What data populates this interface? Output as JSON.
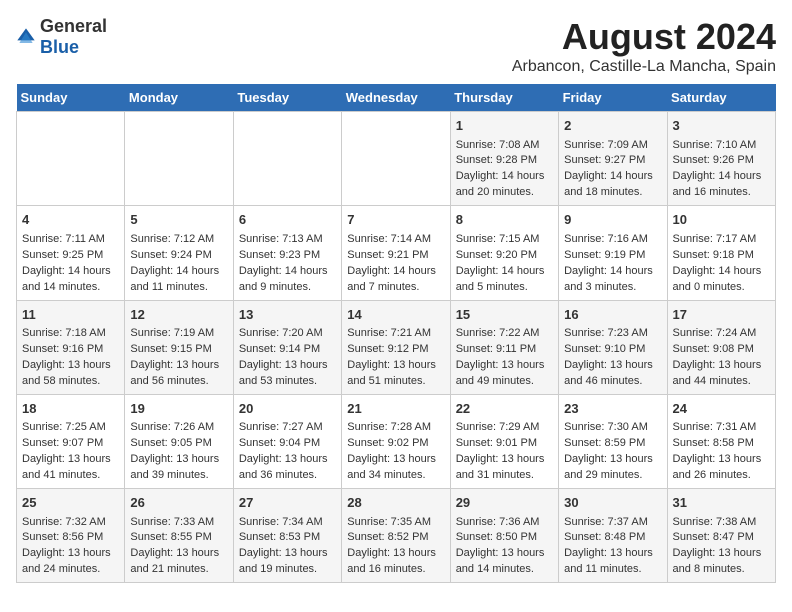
{
  "header": {
    "logo_general": "General",
    "logo_blue": "Blue",
    "title": "August 2024",
    "subtitle": "Arbancon, Castille-La Mancha, Spain"
  },
  "weekdays": [
    "Sunday",
    "Monday",
    "Tuesday",
    "Wednesday",
    "Thursday",
    "Friday",
    "Saturday"
  ],
  "weeks": [
    [
      {
        "day": "",
        "content": ""
      },
      {
        "day": "",
        "content": ""
      },
      {
        "day": "",
        "content": ""
      },
      {
        "day": "",
        "content": ""
      },
      {
        "day": "1",
        "content": "Sunrise: 7:08 AM\nSunset: 9:28 PM\nDaylight: 14 hours\nand 20 minutes."
      },
      {
        "day": "2",
        "content": "Sunrise: 7:09 AM\nSunset: 9:27 PM\nDaylight: 14 hours\nand 18 minutes."
      },
      {
        "day": "3",
        "content": "Sunrise: 7:10 AM\nSunset: 9:26 PM\nDaylight: 14 hours\nand 16 minutes."
      }
    ],
    [
      {
        "day": "4",
        "content": "Sunrise: 7:11 AM\nSunset: 9:25 PM\nDaylight: 14 hours\nand 14 minutes."
      },
      {
        "day": "5",
        "content": "Sunrise: 7:12 AM\nSunset: 9:24 PM\nDaylight: 14 hours\nand 11 minutes."
      },
      {
        "day": "6",
        "content": "Sunrise: 7:13 AM\nSunset: 9:23 PM\nDaylight: 14 hours\nand 9 minutes."
      },
      {
        "day": "7",
        "content": "Sunrise: 7:14 AM\nSunset: 9:21 PM\nDaylight: 14 hours\nand 7 minutes."
      },
      {
        "day": "8",
        "content": "Sunrise: 7:15 AM\nSunset: 9:20 PM\nDaylight: 14 hours\nand 5 minutes."
      },
      {
        "day": "9",
        "content": "Sunrise: 7:16 AM\nSunset: 9:19 PM\nDaylight: 14 hours\nand 3 minutes."
      },
      {
        "day": "10",
        "content": "Sunrise: 7:17 AM\nSunset: 9:18 PM\nDaylight: 14 hours\nand 0 minutes."
      }
    ],
    [
      {
        "day": "11",
        "content": "Sunrise: 7:18 AM\nSunset: 9:16 PM\nDaylight: 13 hours\nand 58 minutes."
      },
      {
        "day": "12",
        "content": "Sunrise: 7:19 AM\nSunset: 9:15 PM\nDaylight: 13 hours\nand 56 minutes."
      },
      {
        "day": "13",
        "content": "Sunrise: 7:20 AM\nSunset: 9:14 PM\nDaylight: 13 hours\nand 53 minutes."
      },
      {
        "day": "14",
        "content": "Sunrise: 7:21 AM\nSunset: 9:12 PM\nDaylight: 13 hours\nand 51 minutes."
      },
      {
        "day": "15",
        "content": "Sunrise: 7:22 AM\nSunset: 9:11 PM\nDaylight: 13 hours\nand 49 minutes."
      },
      {
        "day": "16",
        "content": "Sunrise: 7:23 AM\nSunset: 9:10 PM\nDaylight: 13 hours\nand 46 minutes."
      },
      {
        "day": "17",
        "content": "Sunrise: 7:24 AM\nSunset: 9:08 PM\nDaylight: 13 hours\nand 44 minutes."
      }
    ],
    [
      {
        "day": "18",
        "content": "Sunrise: 7:25 AM\nSunset: 9:07 PM\nDaylight: 13 hours\nand 41 minutes."
      },
      {
        "day": "19",
        "content": "Sunrise: 7:26 AM\nSunset: 9:05 PM\nDaylight: 13 hours\nand 39 minutes."
      },
      {
        "day": "20",
        "content": "Sunrise: 7:27 AM\nSunset: 9:04 PM\nDaylight: 13 hours\nand 36 minutes."
      },
      {
        "day": "21",
        "content": "Sunrise: 7:28 AM\nSunset: 9:02 PM\nDaylight: 13 hours\nand 34 minutes."
      },
      {
        "day": "22",
        "content": "Sunrise: 7:29 AM\nSunset: 9:01 PM\nDaylight: 13 hours\nand 31 minutes."
      },
      {
        "day": "23",
        "content": "Sunrise: 7:30 AM\nSunset: 8:59 PM\nDaylight: 13 hours\nand 29 minutes."
      },
      {
        "day": "24",
        "content": "Sunrise: 7:31 AM\nSunset: 8:58 PM\nDaylight: 13 hours\nand 26 minutes."
      }
    ],
    [
      {
        "day": "25",
        "content": "Sunrise: 7:32 AM\nSunset: 8:56 PM\nDaylight: 13 hours\nand 24 minutes."
      },
      {
        "day": "26",
        "content": "Sunrise: 7:33 AM\nSunset: 8:55 PM\nDaylight: 13 hours\nand 21 minutes."
      },
      {
        "day": "27",
        "content": "Sunrise: 7:34 AM\nSunset: 8:53 PM\nDaylight: 13 hours\nand 19 minutes."
      },
      {
        "day": "28",
        "content": "Sunrise: 7:35 AM\nSunset: 8:52 PM\nDaylight: 13 hours\nand 16 minutes."
      },
      {
        "day": "29",
        "content": "Sunrise: 7:36 AM\nSunset: 8:50 PM\nDaylight: 13 hours\nand 14 minutes."
      },
      {
        "day": "30",
        "content": "Sunrise: 7:37 AM\nSunset: 8:48 PM\nDaylight: 13 hours\nand 11 minutes."
      },
      {
        "day": "31",
        "content": "Sunrise: 7:38 AM\nSunset: 8:47 PM\nDaylight: 13 hours\nand 8 minutes."
      }
    ]
  ]
}
